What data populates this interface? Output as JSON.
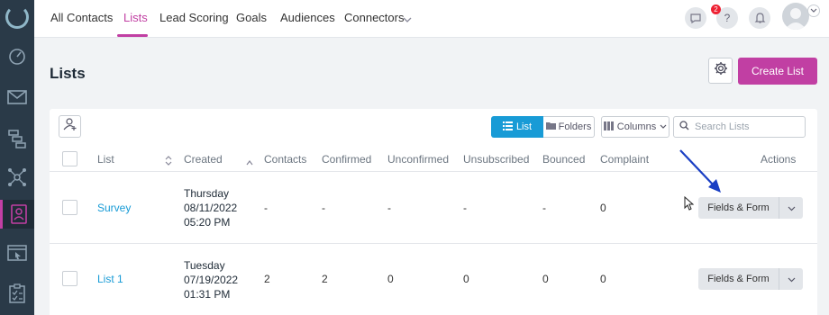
{
  "nav": {
    "tabs": [
      {
        "label": "All Contacts"
      },
      {
        "label": "Lists"
      },
      {
        "label": "Lead Scoring"
      },
      {
        "label": "Goals"
      },
      {
        "label": "Audiences"
      },
      {
        "label": "Connectors"
      }
    ],
    "active_tab": "Lists",
    "help_label": "?",
    "notification_count": "2"
  },
  "page": {
    "title": "Lists",
    "create_button": "Create List"
  },
  "toolbar": {
    "list_view": "List",
    "folders_view": "Folders",
    "columns": "Columns",
    "search_placeholder": "Search Lists"
  },
  "table": {
    "columns": [
      "List",
      "Created",
      "Contacts",
      "Confirmed",
      "Unconfirmed",
      "Unsubscribed",
      "Bounced",
      "Complaint",
      "Actions"
    ],
    "rows": [
      {
        "name": "Survey",
        "created_day": "Thursday",
        "created_date": "08/11/2022",
        "created_time": "05:20 PM",
        "contacts": "-",
        "confirmed": "-",
        "unconfirmed": "-",
        "unsubscribed": "-",
        "bounced": "-",
        "complaint": "0",
        "action": "Fields & Form"
      },
      {
        "name": "List 1",
        "created_day": "Tuesday",
        "created_date": "07/19/2022",
        "created_time": "01:31 PM",
        "contacts": "2",
        "confirmed": "2",
        "unconfirmed": "0",
        "unsubscribed": "0",
        "bounced": "0",
        "complaint": "0",
        "action": "Fields & Form"
      }
    ]
  },
  "colors": {
    "accent": "#c13fa3",
    "primary": "#189bd6",
    "sidebar": "#2a3a48",
    "annotation_arrow": "#1a3fc4"
  }
}
